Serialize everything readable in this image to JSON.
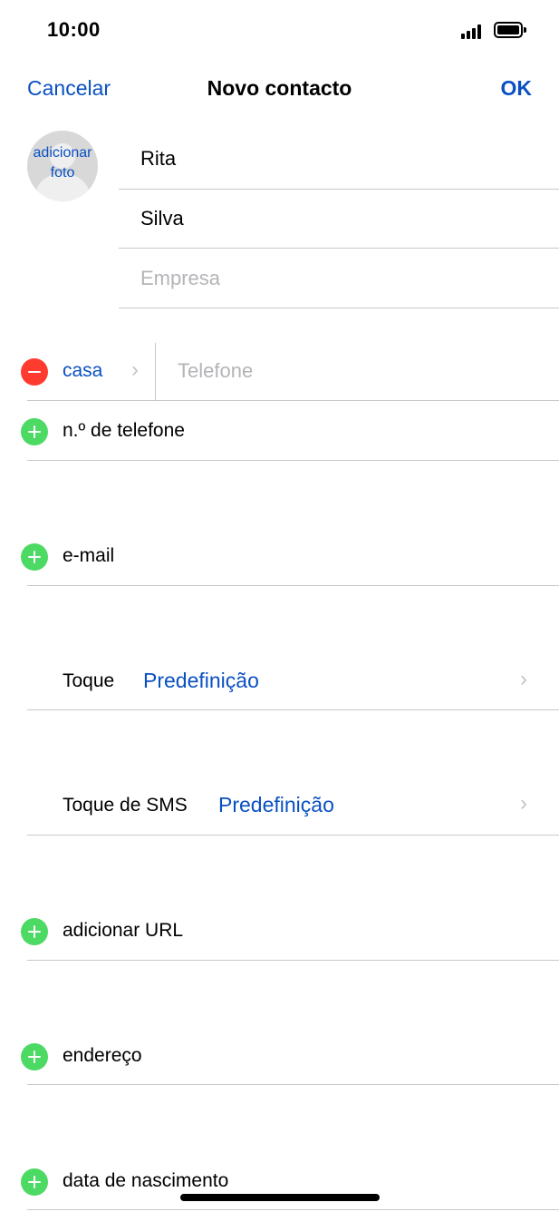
{
  "status_bar": {
    "time": "10:00"
  },
  "nav": {
    "cancel": "Cancelar",
    "title": "Novo contacto",
    "ok": "OK"
  },
  "photo": {
    "label_line1": "adicionar",
    "label_line2": "foto"
  },
  "name_fields": {
    "first_name": "Rita",
    "last_name": "Silva",
    "company_placeholder": "Empresa"
  },
  "phone_row": {
    "label": "casa",
    "placeholder": "Telefone"
  },
  "add_rows": {
    "phone": "n.º de telefone",
    "email": "e-mail",
    "url": "adicionar URL",
    "address": "endereço",
    "birthday": "data de nascimento"
  },
  "ringtone": {
    "label": "Toque",
    "value": "Predefinição"
  },
  "text_tone": {
    "label": "Toque de SMS",
    "value": "Predefinição"
  },
  "colors": {
    "accent": "#0a50c2",
    "add": "#4cd964",
    "remove": "#ff3b30"
  }
}
